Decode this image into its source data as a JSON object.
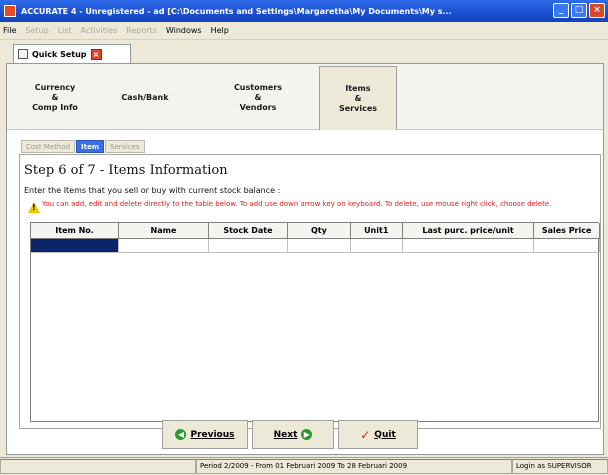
{
  "window": {
    "title": "ACCURATE 4 - Unregistered - ad [C:\\Documents and Settings\\Margaretha\\My Documents\\My s..."
  },
  "menu": {
    "items": [
      {
        "label": "File",
        "enabled": true
      },
      {
        "label": "Setup",
        "enabled": false
      },
      {
        "label": "List",
        "enabled": false
      },
      {
        "label": "Activities",
        "enabled": false
      },
      {
        "label": "Reports",
        "enabled": false
      },
      {
        "label": "Windows",
        "enabled": true
      },
      {
        "label": "Help",
        "enabled": true
      }
    ]
  },
  "doc_tab": {
    "label": "Quick Setup"
  },
  "steps": [
    {
      "label": "Currency\n&\nComp Info",
      "active": false
    },
    {
      "label": "Cash/Bank",
      "active": false
    },
    {
      "label": "Customers\n&\nVendors",
      "active": false
    },
    {
      "label": "Items\n&\nServices",
      "active": true
    }
  ],
  "subtabs": [
    {
      "label": "Cost Method",
      "active": false
    },
    {
      "label": "Item",
      "active": true
    },
    {
      "label": "Services",
      "active": false
    }
  ],
  "content": {
    "title": "Step 6 of 7  - Items Information",
    "instructions": "Enter the Items that you sell or buy with current stock balance :",
    "warning": "You can add, edit and delete directly to the table below. To add use down arrow key on keyboard. To delete, use mouse right click, choose delete."
  },
  "table": {
    "columns": [
      "Item No.",
      "Name",
      "Stock Date",
      "Qty",
      "Unit1",
      "Last purc. price/unit",
      "Sales Price"
    ]
  },
  "buttons": {
    "previous": "Previous",
    "next": "Next",
    "quit": "Quit"
  },
  "status": {
    "period": "Period 2/2009 - From 01 Februari 2009 To 28 Februari 2009",
    "login": "Login as SUPERVISOR"
  },
  "colors": {
    "title_bar": "#1a4fd0",
    "warning_text": "#e02020",
    "selected_cell": "#0a246a",
    "active_subtab": "#3a6ee8"
  }
}
